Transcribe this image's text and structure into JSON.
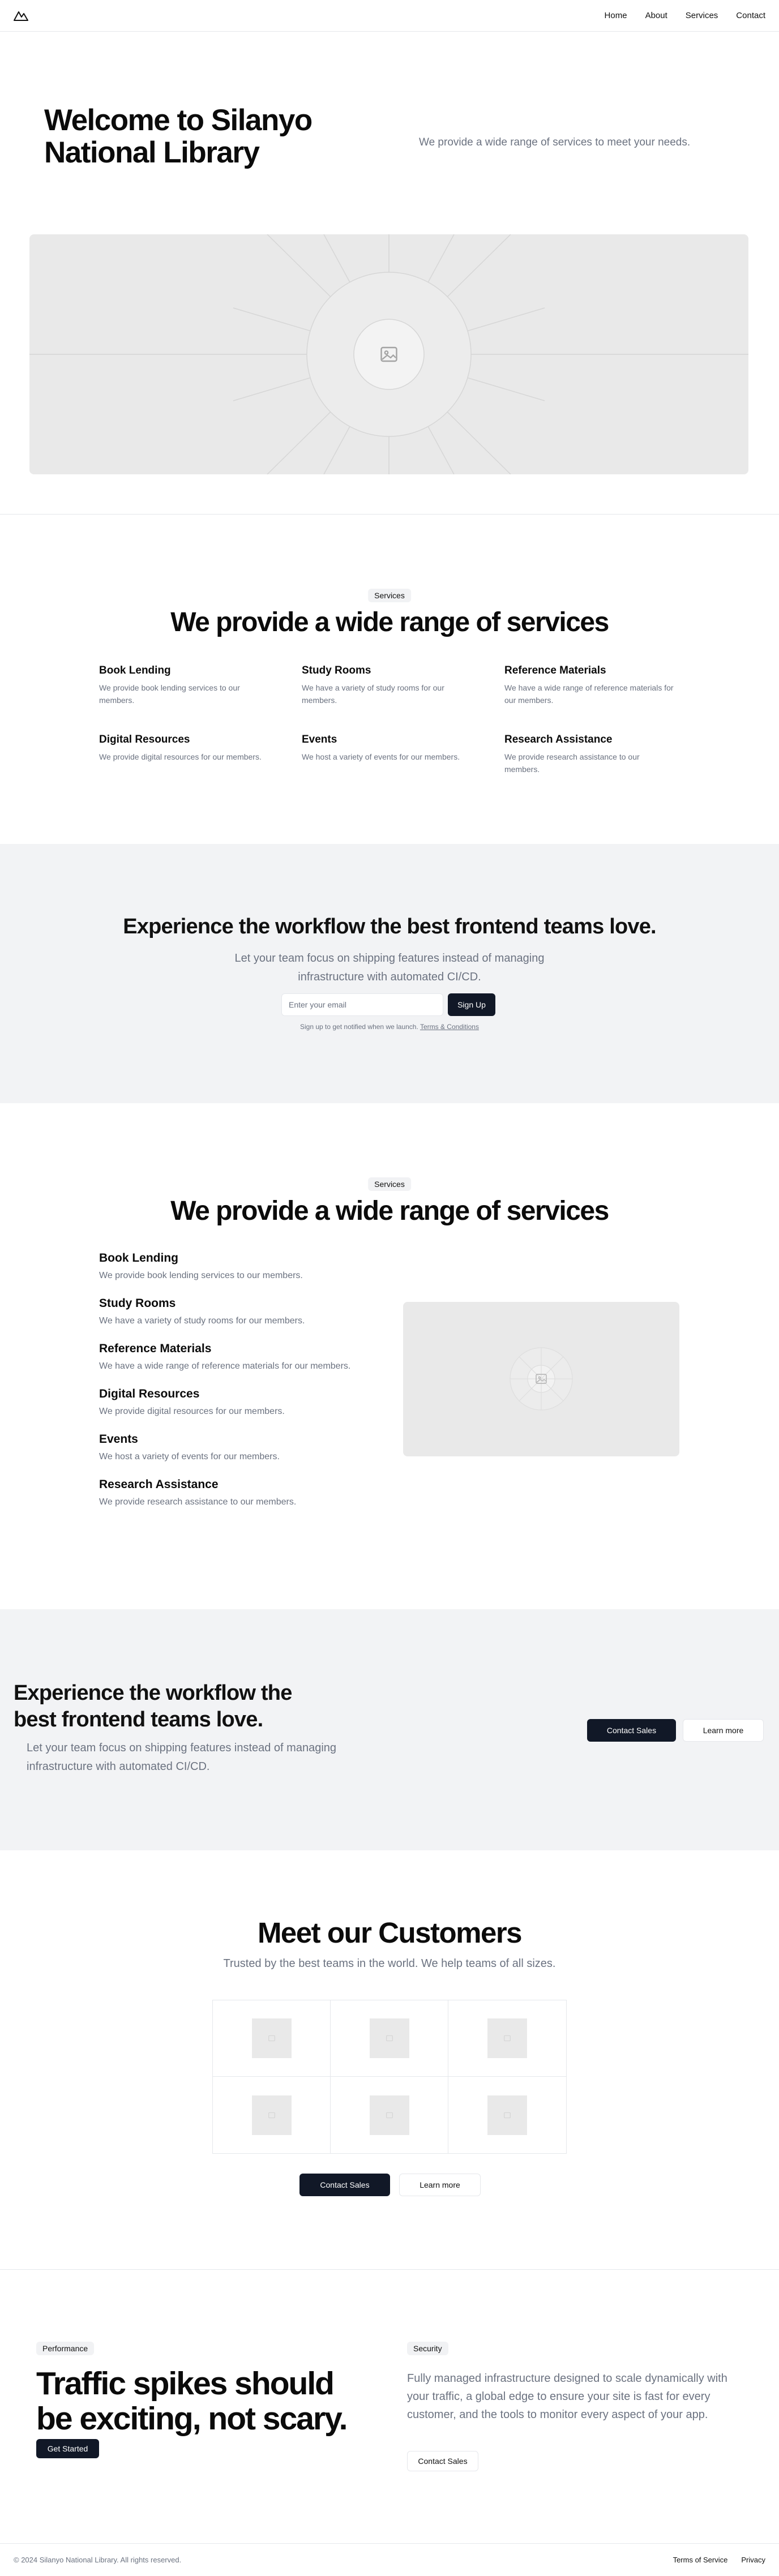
{
  "nav": {
    "items": [
      "Home",
      "About",
      "Services",
      "Contact"
    ]
  },
  "hero": {
    "title": "Welcome to Silanyo National Library",
    "subtitle": "We provide a wide range of services to meet your needs."
  },
  "services": {
    "badge": "Services",
    "title": "We provide a wide range of services",
    "items": [
      {
        "title": "Book Lending",
        "desc": "We provide book lending services to our members."
      },
      {
        "title": "Study Rooms",
        "desc": "We have a variety of study rooms for our members."
      },
      {
        "title": "Reference Materials",
        "desc": "We have a wide range of reference materials for our members."
      },
      {
        "title": "Digital Resources",
        "desc": "We provide digital resources for our members."
      },
      {
        "title": "Events",
        "desc": "We host a variety of events for our members."
      },
      {
        "title": "Research Assistance",
        "desc": "We provide research assistance to our members."
      }
    ]
  },
  "cta1": {
    "title": "Experience the workflow the best frontend teams love.",
    "subtitle_line1": "Let your team focus on shipping features instead of managing",
    "subtitle_line2": "infrastructure with automated CI/CD.",
    "email_placeholder": "Enter your email",
    "signup_label": "Sign Up",
    "fine_text": "Sign up to get notified when we launch.",
    "terms_label": "Terms & Conditions"
  },
  "services2": {
    "badge": "Services",
    "title": "We provide a wide range of services",
    "items": [
      {
        "title": "Book Lending",
        "desc": "We provide book lending services to our members."
      },
      {
        "title": "Study Rooms",
        "desc": "We have a variety of study rooms for our members."
      },
      {
        "title": "Reference Materials",
        "desc": "We have a wide range of reference materials for our members."
      },
      {
        "title": "Digital Resources",
        "desc": "We provide digital resources for our members."
      },
      {
        "title": "Events",
        "desc": "We host a variety of events for our members."
      },
      {
        "title": "Research Assistance",
        "desc": "We provide research assistance to our members."
      }
    ]
  },
  "cta2": {
    "title": "Experience the workflow the best frontend teams love.",
    "subtitle": "Let your team focus on shipping features instead of managing infrastructure with automated CI/CD.",
    "contact_label": "Contact Sales",
    "learn_label": "Learn more"
  },
  "customers": {
    "title": "Meet our Customers",
    "subtitle": "Trusted by the best teams in the world. We help teams of all sizes.",
    "contact_label": "Contact Sales",
    "learn_label": "Learn more"
  },
  "traffic": {
    "badge_left": "Performance",
    "title": "Traffic spikes should be exciting, not scary.",
    "get_started_label": "Get Started",
    "badge_right": "Security",
    "description": "Fully managed infrastructure designed to scale dynamically with your traffic, a global edge to ensure your site is fast for every customer, and the tools to monitor every aspect of your app.",
    "contact_label": "Contact Sales"
  },
  "footer": {
    "copyright": "© 2024 Silanyo National Library. All rights reserved.",
    "terms_label": "Terms of Service",
    "privacy_label": "Privacy"
  },
  "colors": {
    "dark_button": "#111827",
    "muted_text": "#6b7280",
    "band_background": "#f2f3f5",
    "placeholder_background": "#e9e9e9"
  },
  "icons": {
    "logo": "mountain-logo-icon",
    "image_placeholder": "image-icon"
  }
}
